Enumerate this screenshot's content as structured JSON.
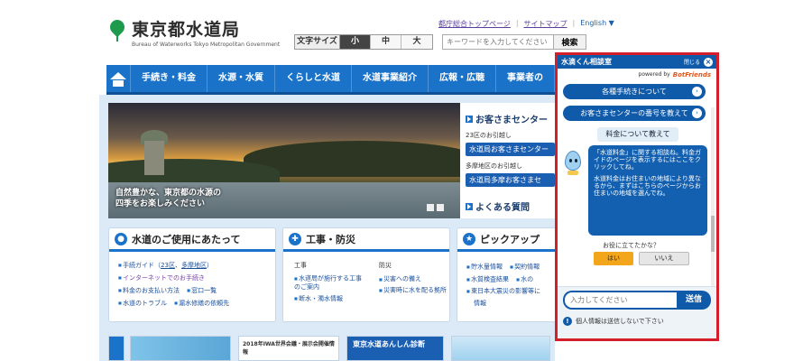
{
  "header": {
    "org_name": "東京都水道局",
    "org_name_en": "Bureau of Waterworks Tokyo Metropolitan Government",
    "top_links": [
      "都庁総合トップページ",
      "サイトマップ",
      "English ▼"
    ],
    "font_size_label": "文字サイズ",
    "font_sizes": [
      "小",
      "中",
      "大"
    ],
    "search_placeholder": "キーワードを入力してください",
    "search_button": "検索"
  },
  "nav": {
    "items": [
      "手続き・料金",
      "水源・水質",
      "くらしと水道",
      "水道事業紹介",
      "広報・広聴",
      "事業者の"
    ]
  },
  "hero": {
    "caption_line1": "自然豊かな、東京都の水源の",
    "caption_line2": "四季をお楽しみください"
  },
  "side": {
    "customer_center": "お客さまセンター",
    "area1_label": "23区のお引越し",
    "area1_button": "水道局お客さまセンター",
    "area2_label": "多摩地区のお引越し",
    "area2_button": "水道局多摩お客さまセ",
    "faq": "よくある質問"
  },
  "cards": {
    "usage": {
      "title": "水道のご使用にあたって",
      "links": [
        [
          "手続ガイド（",
          "23区",
          "、",
          "多摩地区",
          "）"
        ],
        "インターネットでのお手続き",
        "料金のお支払い方法",
        "窓口一覧",
        "水道のトラブル",
        "漏水修繕の依頼先"
      ]
    },
    "construction": {
      "title": "工事・防災",
      "col1_label": "工事",
      "col1_links": [
        "水道局が施行する工事のご案内",
        "断水・濁水情報"
      ],
      "col2_label": "防災",
      "col2_links": [
        "災害への備え",
        "災害時に水を配る拠所"
      ]
    },
    "pickup": {
      "title": "ピックアップ",
      "links": [
        "貯水量情報",
        "契約情報",
        "水質検査結果",
        "水の",
        "東日本大震災の影響等に",
        "情報"
      ]
    }
  },
  "banners": {
    "b2_text": "2018年IWA世界会議・展示会開催情報",
    "b3_text": "東京水道あんしん診断"
  },
  "chat": {
    "title": "水滴くん相談室",
    "minimize": "閉じる",
    "powered_by": "powered by",
    "brand": "BotFriends",
    "quick1": "各種手続きについて",
    "quick2": "お客さまセンターの番号を教えて",
    "user_msg": "料金について教えて",
    "bot_p1": "「水道料金」に関する相談ね。料金ガイドのページを表示するにはここをクリックしてね。",
    "bot_p2": "水道料金はお住まいの地域により異なるから、まずはこちらのページからお住まいの地域を選んでね。",
    "helpful_q": "お役に立てたかな？",
    "yes": "はい",
    "no": "いいえ",
    "input_placeholder": "入力してください",
    "send": "送信",
    "notice": "個人情報は送信しないで下さい"
  },
  "colors": {
    "brand_blue": "#1b73c9",
    "chat_blue": "#0f5aa9",
    "highlight_red": "#d41f2a",
    "logo_green": "#1d9a4b",
    "yes_orange": "#f3a51c"
  }
}
